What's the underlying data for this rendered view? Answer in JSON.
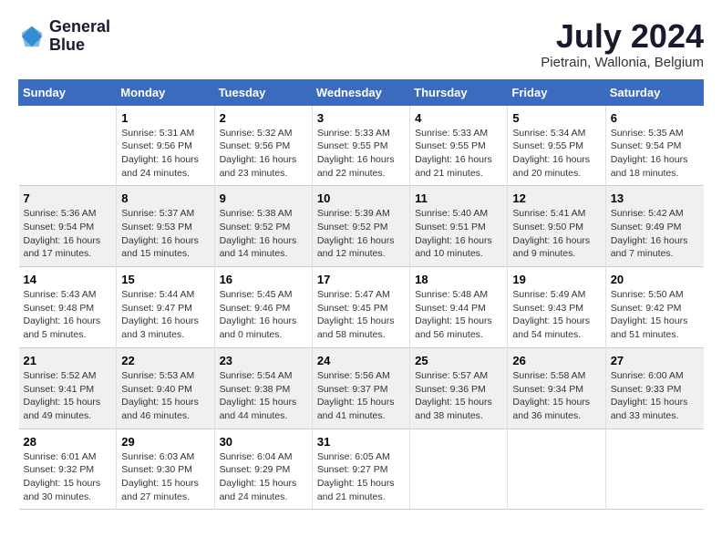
{
  "logo": {
    "line1": "General",
    "line2": "Blue"
  },
  "title": "July 2024",
  "location": "Pietrain, Wallonia, Belgium",
  "weekdays": [
    "Sunday",
    "Monday",
    "Tuesday",
    "Wednesday",
    "Thursday",
    "Friday",
    "Saturday"
  ],
  "weeks": [
    [
      {
        "day": "",
        "sunrise": "",
        "sunset": "",
        "daylight": ""
      },
      {
        "day": "1",
        "sunrise": "Sunrise: 5:31 AM",
        "sunset": "Sunset: 9:56 PM",
        "daylight": "Daylight: 16 hours and 24 minutes."
      },
      {
        "day": "2",
        "sunrise": "Sunrise: 5:32 AM",
        "sunset": "Sunset: 9:56 PM",
        "daylight": "Daylight: 16 hours and 23 minutes."
      },
      {
        "day": "3",
        "sunrise": "Sunrise: 5:33 AM",
        "sunset": "Sunset: 9:55 PM",
        "daylight": "Daylight: 16 hours and 22 minutes."
      },
      {
        "day": "4",
        "sunrise": "Sunrise: 5:33 AM",
        "sunset": "Sunset: 9:55 PM",
        "daylight": "Daylight: 16 hours and 21 minutes."
      },
      {
        "day": "5",
        "sunrise": "Sunrise: 5:34 AM",
        "sunset": "Sunset: 9:55 PM",
        "daylight": "Daylight: 16 hours and 20 minutes."
      },
      {
        "day": "6",
        "sunrise": "Sunrise: 5:35 AM",
        "sunset": "Sunset: 9:54 PM",
        "daylight": "Daylight: 16 hours and 18 minutes."
      }
    ],
    [
      {
        "day": "7",
        "sunrise": "Sunrise: 5:36 AM",
        "sunset": "Sunset: 9:54 PM",
        "daylight": "Daylight: 16 hours and 17 minutes."
      },
      {
        "day": "8",
        "sunrise": "Sunrise: 5:37 AM",
        "sunset": "Sunset: 9:53 PM",
        "daylight": "Daylight: 16 hours and 15 minutes."
      },
      {
        "day": "9",
        "sunrise": "Sunrise: 5:38 AM",
        "sunset": "Sunset: 9:52 PM",
        "daylight": "Daylight: 16 hours and 14 minutes."
      },
      {
        "day": "10",
        "sunrise": "Sunrise: 5:39 AM",
        "sunset": "Sunset: 9:52 PM",
        "daylight": "Daylight: 16 hours and 12 minutes."
      },
      {
        "day": "11",
        "sunrise": "Sunrise: 5:40 AM",
        "sunset": "Sunset: 9:51 PM",
        "daylight": "Daylight: 16 hours and 10 minutes."
      },
      {
        "day": "12",
        "sunrise": "Sunrise: 5:41 AM",
        "sunset": "Sunset: 9:50 PM",
        "daylight": "Daylight: 16 hours and 9 minutes."
      },
      {
        "day": "13",
        "sunrise": "Sunrise: 5:42 AM",
        "sunset": "Sunset: 9:49 PM",
        "daylight": "Daylight: 16 hours and 7 minutes."
      }
    ],
    [
      {
        "day": "14",
        "sunrise": "Sunrise: 5:43 AM",
        "sunset": "Sunset: 9:48 PM",
        "daylight": "Daylight: 16 hours and 5 minutes."
      },
      {
        "day": "15",
        "sunrise": "Sunrise: 5:44 AM",
        "sunset": "Sunset: 9:47 PM",
        "daylight": "Daylight: 16 hours and 3 minutes."
      },
      {
        "day": "16",
        "sunrise": "Sunrise: 5:45 AM",
        "sunset": "Sunset: 9:46 PM",
        "daylight": "Daylight: 16 hours and 0 minutes."
      },
      {
        "day": "17",
        "sunrise": "Sunrise: 5:47 AM",
        "sunset": "Sunset: 9:45 PM",
        "daylight": "Daylight: 15 hours and 58 minutes."
      },
      {
        "day": "18",
        "sunrise": "Sunrise: 5:48 AM",
        "sunset": "Sunset: 9:44 PM",
        "daylight": "Daylight: 15 hours and 56 minutes."
      },
      {
        "day": "19",
        "sunrise": "Sunrise: 5:49 AM",
        "sunset": "Sunset: 9:43 PM",
        "daylight": "Daylight: 15 hours and 54 minutes."
      },
      {
        "day": "20",
        "sunrise": "Sunrise: 5:50 AM",
        "sunset": "Sunset: 9:42 PM",
        "daylight": "Daylight: 15 hours and 51 minutes."
      }
    ],
    [
      {
        "day": "21",
        "sunrise": "Sunrise: 5:52 AM",
        "sunset": "Sunset: 9:41 PM",
        "daylight": "Daylight: 15 hours and 49 minutes."
      },
      {
        "day": "22",
        "sunrise": "Sunrise: 5:53 AM",
        "sunset": "Sunset: 9:40 PM",
        "daylight": "Daylight: 15 hours and 46 minutes."
      },
      {
        "day": "23",
        "sunrise": "Sunrise: 5:54 AM",
        "sunset": "Sunset: 9:38 PM",
        "daylight": "Daylight: 15 hours and 44 minutes."
      },
      {
        "day": "24",
        "sunrise": "Sunrise: 5:56 AM",
        "sunset": "Sunset: 9:37 PM",
        "daylight": "Daylight: 15 hours and 41 minutes."
      },
      {
        "day": "25",
        "sunrise": "Sunrise: 5:57 AM",
        "sunset": "Sunset: 9:36 PM",
        "daylight": "Daylight: 15 hours and 38 minutes."
      },
      {
        "day": "26",
        "sunrise": "Sunrise: 5:58 AM",
        "sunset": "Sunset: 9:34 PM",
        "daylight": "Daylight: 15 hours and 36 minutes."
      },
      {
        "day": "27",
        "sunrise": "Sunrise: 6:00 AM",
        "sunset": "Sunset: 9:33 PM",
        "daylight": "Daylight: 15 hours and 33 minutes."
      }
    ],
    [
      {
        "day": "28",
        "sunrise": "Sunrise: 6:01 AM",
        "sunset": "Sunset: 9:32 PM",
        "daylight": "Daylight: 15 hours and 30 minutes."
      },
      {
        "day": "29",
        "sunrise": "Sunrise: 6:03 AM",
        "sunset": "Sunset: 9:30 PM",
        "daylight": "Daylight: 15 hours and 27 minutes."
      },
      {
        "day": "30",
        "sunrise": "Sunrise: 6:04 AM",
        "sunset": "Sunset: 9:29 PM",
        "daylight": "Daylight: 15 hours and 24 minutes."
      },
      {
        "day": "31",
        "sunrise": "Sunrise: 6:05 AM",
        "sunset": "Sunset: 9:27 PM",
        "daylight": "Daylight: 15 hours and 21 minutes."
      },
      {
        "day": "",
        "sunrise": "",
        "sunset": "",
        "daylight": ""
      },
      {
        "day": "",
        "sunrise": "",
        "sunset": "",
        "daylight": ""
      },
      {
        "day": "",
        "sunrise": "",
        "sunset": "",
        "daylight": ""
      }
    ]
  ]
}
